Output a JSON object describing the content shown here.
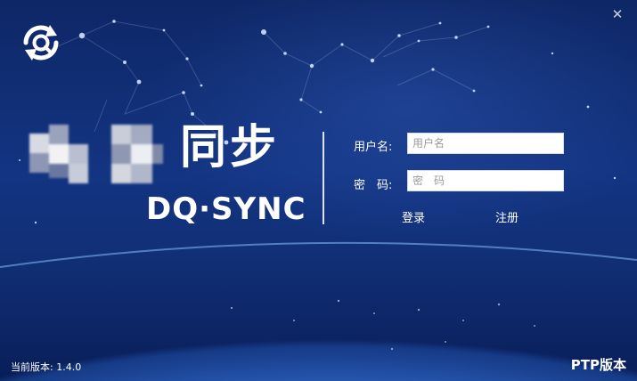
{
  "window": {
    "close_icon": "close-icon",
    "close_glyph": "✕"
  },
  "app": {
    "logo_icon": "sync-logo-icon"
  },
  "brand": {
    "title_cn": "同步",
    "title_en": "DQ·SYNC",
    "mosaic": "pixelated-logo-image"
  },
  "login": {
    "username_label": "用户名:",
    "username_placeholder": "用户名",
    "username_value": "",
    "password_label": "密　码:",
    "password_placeholder": "密　码",
    "password_value": "",
    "login_label": "登录",
    "register_label": "注册"
  },
  "footer": {
    "version_text": "当前版本: 1.4.0",
    "edition_text": "PTP版本"
  },
  "colors": {
    "background_dark": "#0e2766",
    "background_mid": "#133482",
    "earth_glow": "#5b93e8",
    "text": "#ffffff"
  }
}
